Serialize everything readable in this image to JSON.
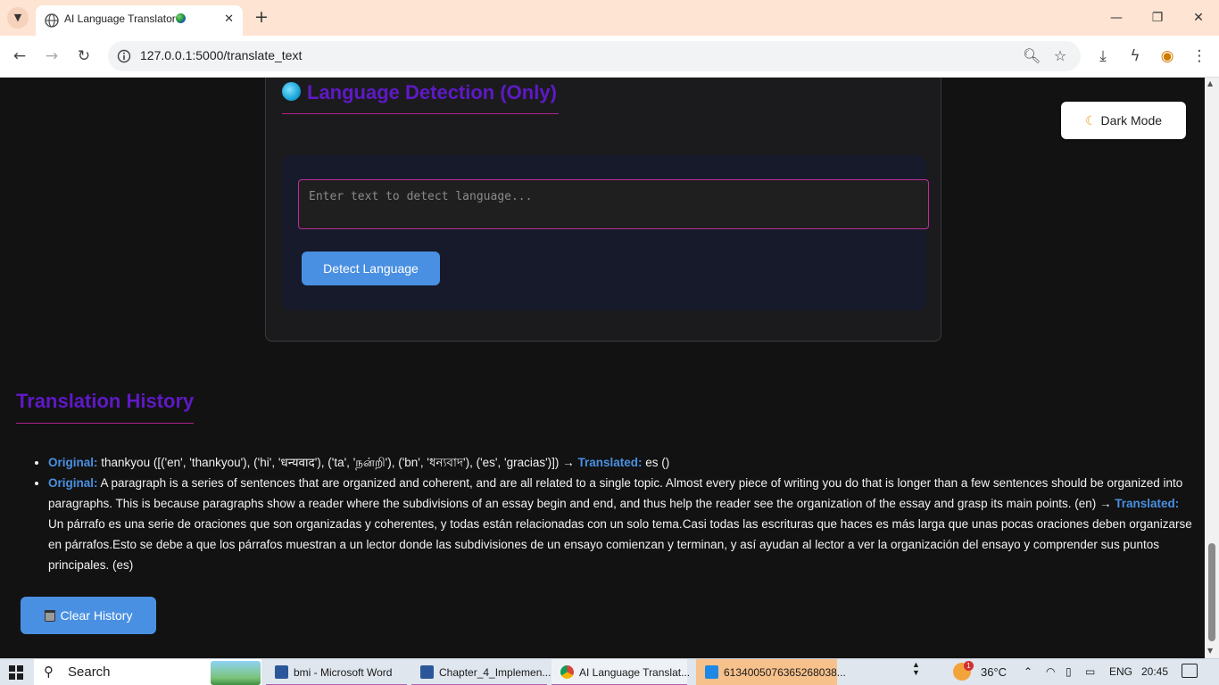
{
  "browser": {
    "tab_title": "AI Language Translator",
    "url": "127.0.0.1:5000/translate_text",
    "new_tab_symbol": "+",
    "close_symbol": "✕",
    "back_symbol": "←",
    "forward_symbol": "→",
    "reload_symbol": "↻",
    "menu_symbol": "⋮"
  },
  "detection": {
    "title": "Language Detection (Only)",
    "input_placeholder": "Enter text to detect language...",
    "input_value": "",
    "button_label": "Detect Language"
  },
  "dark_mode": {
    "label": "Dark Mode",
    "icon": "moon-icon"
  },
  "history": {
    "title": "Translation History",
    "original_label": "Original:",
    "translated_label": "Translated:",
    "items": [
      {
        "original": "thankyou ([('en', 'thankyou'), ('hi', 'धन्यवाद'), ('ta', 'நன்றி'), ('bn', 'ধন্যবাদ'), ('es', 'gracias')]) →",
        "translated": "es ()"
      },
      {
        "original": "A paragraph is a series of sentences that are organized and coherent, and are all related to a single topic. Almost every piece of writing you do that is longer than a few sentences should be organized into paragraphs. This is because paragraphs show a reader where the subdivisions of an essay begin and end, and thus help the reader see the organization of the essay and grasp its main points. (en) →",
        "translated": "Un párrafo es una serie de oraciones que son organizadas y coherentes, y todas están relacionadas con un solo tema.Casi todas las escrituras que haces es más larga que unas pocas oraciones deben organizarse en párrafos.Esto se debe a que los párrafos muestran a un lector donde las subdivisiones de un ensayo comienzan y terminan, y así ayudan al lector a ver la organización del ensayo y comprender sus puntos principales. (es)"
      }
    ],
    "clear_label": "Clear History"
  },
  "taskbar": {
    "search_label": "Search",
    "items": [
      {
        "label": "bmi - Microsoft Word"
      },
      {
        "label": "Chapter_4_Implemen..."
      },
      {
        "label": "AI Language Translat..."
      },
      {
        "label": "6134005076365268038..."
      }
    ],
    "weather_temp": "36°C",
    "weather_badge": "1",
    "language": "ENG",
    "time": "20:45"
  },
  "colors": {
    "accent_blue": "#4a90e2",
    "title_purple": "#5f19c6",
    "border_magenta": "#c02c9b",
    "page_background": "#121212"
  }
}
